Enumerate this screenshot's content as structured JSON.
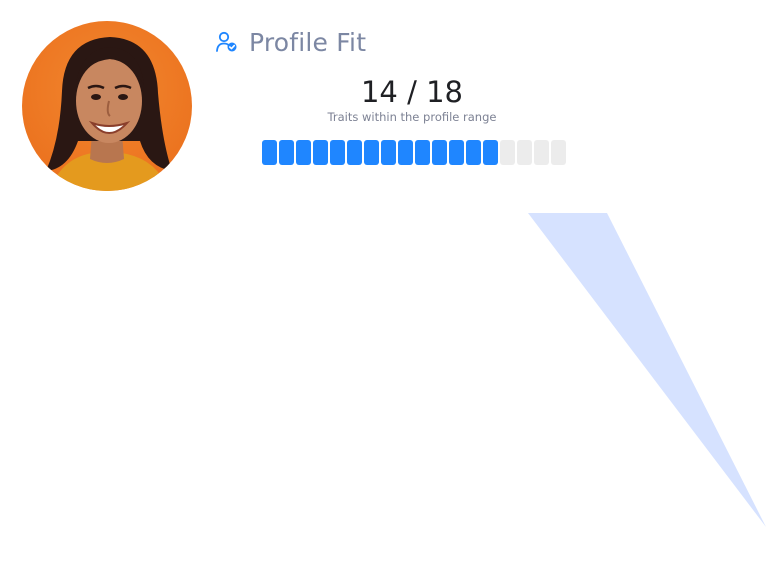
{
  "header": {
    "icon": "user-check-icon",
    "title": "Profile Fit"
  },
  "avatar": {
    "description_icon": "avatar"
  },
  "score": {
    "text": "14 / 18",
    "matched": 14,
    "total": 18,
    "subtitle": "Traits within the profile range"
  },
  "colors": {
    "accent": "#1f86ff",
    "inactive_segment": "#ececec",
    "title": "#7c87a3",
    "wedge": "#d6e2ff",
    "avatar_bg": "#ec7420"
  }
}
